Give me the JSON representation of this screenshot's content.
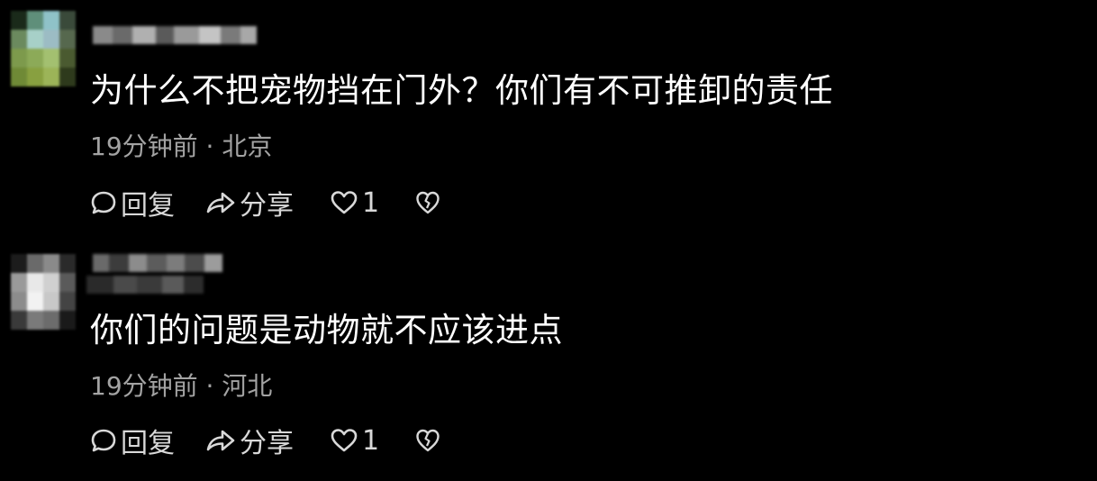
{
  "comments": [
    {
      "text": "为什么不把宠物挡在门外？你们有不可推卸的责任",
      "meta": "19分钟前 · 北京",
      "reply_label": "回复",
      "share_label": "分享",
      "like_count": "1",
      "icons": [
        "comment-icon",
        "share-icon",
        "heart-icon",
        "broken-heart-icon"
      ]
    },
    {
      "text": "你们的问题是动物就不应该进点",
      "meta": "19分钟前 · 河北",
      "reply_label": "回复",
      "share_label": "分享",
      "like_count": "1",
      "icons": [
        "comment-icon",
        "share-icon",
        "heart-icon",
        "broken-heart-icon"
      ]
    }
  ],
  "colors": {
    "background": "#000000",
    "text": "#ffffff",
    "meta": "#a3a3a3",
    "action": "#d8d8d8"
  }
}
